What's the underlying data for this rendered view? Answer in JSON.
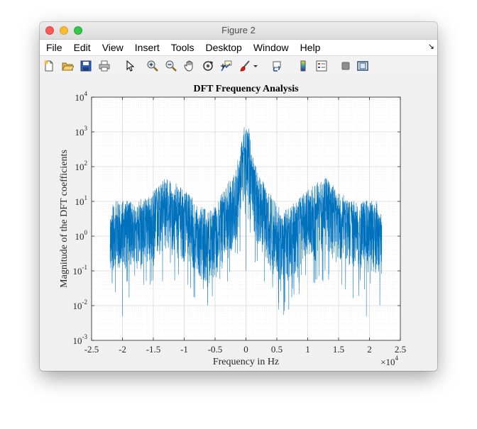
{
  "window": {
    "title": "Figure 2"
  },
  "menu": [
    "File",
    "Edit",
    "View",
    "Insert",
    "Tools",
    "Desktop",
    "Window",
    "Help"
  ],
  "toolbar_icons": [
    "new-figure-icon",
    "open-file-icon",
    "save-icon",
    "print-icon",
    "pointer-icon",
    "zoom-in-icon",
    "zoom-out-icon",
    "pan-hand-icon",
    "rotate-3d-icon",
    "data-cursor-icon",
    "brush-icon",
    "brush-dropdown-icon",
    "link-plot-icon",
    "colorbar-icon",
    "legend-icon",
    "hide-plot-tools-icon",
    "show-plot-tools-icon"
  ],
  "colors": {
    "line": "#0072bd",
    "grid": "#d9d9d9",
    "axes": "#262626"
  },
  "chart_data": {
    "type": "line",
    "title": "DFT Frequency Analysis",
    "xlabel": "Frequency in Hz",
    "ylabel": "Magnitude of the DFT coefficients",
    "x_multiplier": "×10",
    "x_multiplier_exp": "4",
    "xlim": [
      -2.5,
      2.5
    ],
    "ylim": [
      0.001,
      10000
    ],
    "yscale": "log",
    "grid": true,
    "minor_grid": true,
    "xticks": [
      "-2.5",
      "-2",
      "-1.5",
      "-1",
      "-0.5",
      "0",
      "0.5",
      "1",
      "1.5",
      "2",
      "2.5"
    ],
    "yticks": [
      {
        "base": "10",
        "exp": "-3"
      },
      {
        "base": "10",
        "exp": "-2"
      },
      {
        "base": "10",
        "exp": "-1"
      },
      {
        "base": "10",
        "exp": "0"
      },
      {
        "base": "10",
        "exp": "1"
      },
      {
        "base": "10",
        "exp": "2"
      },
      {
        "base": "10",
        "exp": "3"
      },
      {
        "base": "10",
        "exp": "4"
      }
    ],
    "series": [
      {
        "x_range": [
          -2.2,
          2.2
        ],
        "envelope_upper": [
          [
            -2.2,
            3
          ],
          [
            -2.15,
            10
          ],
          [
            -2.0,
            12
          ],
          [
            -1.8,
            9
          ],
          [
            -1.6,
            15
          ],
          [
            -1.45,
            25
          ],
          [
            -1.3,
            50
          ],
          [
            -1.15,
            35
          ],
          [
            -1.0,
            22
          ],
          [
            -0.8,
            10
          ],
          [
            -0.6,
            5
          ],
          [
            -0.5,
            8
          ],
          [
            -0.35,
            25
          ],
          [
            -0.2,
            60
          ],
          [
            -0.1,
            300
          ],
          [
            -0.05,
            1200
          ],
          [
            0.0,
            3000
          ],
          [
            0.05,
            1200
          ],
          [
            0.1,
            300
          ],
          [
            0.2,
            60
          ],
          [
            0.35,
            25
          ],
          [
            0.5,
            8
          ],
          [
            0.6,
            5
          ],
          [
            0.8,
            10
          ],
          [
            1.0,
            22
          ],
          [
            1.15,
            35
          ],
          [
            1.3,
            50
          ],
          [
            1.45,
            25
          ],
          [
            1.6,
            15
          ],
          [
            1.8,
            9
          ],
          [
            2.0,
            12
          ],
          [
            2.15,
            10
          ],
          [
            2.2,
            3
          ]
        ],
        "envelope_typical": [
          [
            -2.2,
            1.5
          ],
          [
            -2.0,
            2
          ],
          [
            -1.7,
            2.5
          ],
          [
            -1.5,
            4
          ],
          [
            -1.3,
            8
          ],
          [
            -1.1,
            6
          ],
          [
            -0.9,
            3
          ],
          [
            -0.7,
            1
          ],
          [
            -0.6,
            0.8
          ],
          [
            -0.45,
            1.5
          ],
          [
            -0.3,
            4
          ],
          [
            -0.15,
            15
          ],
          [
            -0.05,
            150
          ],
          [
            0.0,
            400
          ],
          [
            0.05,
            150
          ],
          [
            0.15,
            15
          ],
          [
            0.3,
            4
          ],
          [
            0.45,
            1.5
          ],
          [
            0.6,
            0.8
          ],
          [
            0.7,
            1
          ],
          [
            0.9,
            3
          ],
          [
            1.1,
            6
          ],
          [
            1.3,
            8
          ],
          [
            1.5,
            4
          ],
          [
            1.7,
            2.5
          ],
          [
            2.0,
            2
          ],
          [
            2.2,
            1.5
          ]
        ],
        "notable_minima": [
          {
            "x": -2.0,
            "y": 0.005
          },
          {
            "x": -1.55,
            "y": 0.04
          },
          {
            "x": -0.62,
            "y": 0.01
          },
          {
            "x": -0.3,
            "y": 0.05
          },
          {
            "x": 0.0,
            "y": 0.1
          },
          {
            "x": 0.3,
            "y": 0.05
          },
          {
            "x": 0.62,
            "y": 0.01
          },
          {
            "x": 1.55,
            "y": 0.04
          },
          {
            "x": 1.95,
            "y": 0.005
          }
        ]
      }
    ]
  }
}
